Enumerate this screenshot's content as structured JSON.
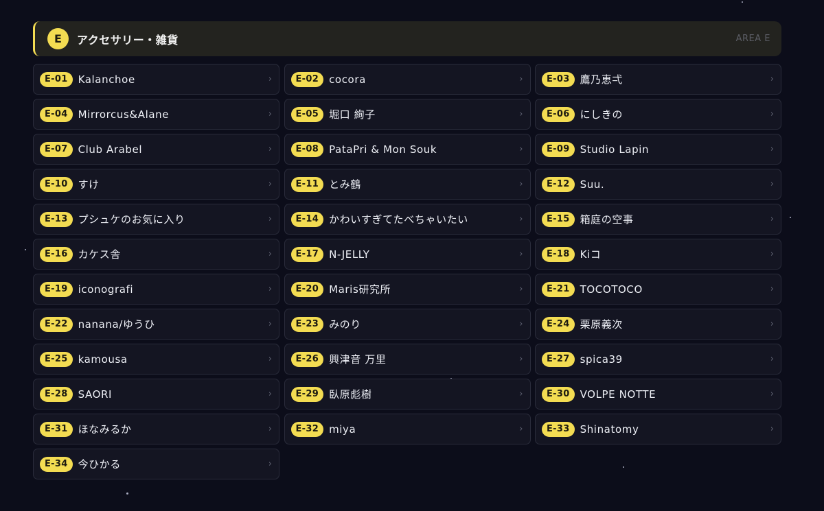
{
  "section": {
    "badge": "E",
    "title": "アクセサリー・雑貨",
    "area_label": "AREA E"
  },
  "icons": {
    "chevron": "chevron-right-icon"
  },
  "colors": {
    "background": "#0c0d1a",
    "accent": "#f3dc52",
    "card": "#141522"
  },
  "booths": [
    {
      "code": "E-01",
      "name": "Kalanchoe"
    },
    {
      "code": "E-02",
      "name": "cocora"
    },
    {
      "code": "E-03",
      "name": "鷹乃恵弌"
    },
    {
      "code": "E-04",
      "name": "Mirrorcus&Alane"
    },
    {
      "code": "E-05",
      "name": "堀口 絢子"
    },
    {
      "code": "E-06",
      "name": "にしきの"
    },
    {
      "code": "E-07",
      "name": "Club Arabel"
    },
    {
      "code": "E-08",
      "name": "PataPri & Mon Souk"
    },
    {
      "code": "E-09",
      "name": "Studio Lapin"
    },
    {
      "code": "E-10",
      "name": "すけ"
    },
    {
      "code": "E-11",
      "name": "とみ鶴"
    },
    {
      "code": "E-12",
      "name": "Suu."
    },
    {
      "code": "E-13",
      "name": "プシュケのお気に入り"
    },
    {
      "code": "E-14",
      "name": "かわいすぎてたべちゃいたい"
    },
    {
      "code": "E-15",
      "name": "箱庭の空事"
    },
    {
      "code": "E-16",
      "name": "カケス舎"
    },
    {
      "code": "E-17",
      "name": "N-JELLY"
    },
    {
      "code": "E-18",
      "name": "Kiコ"
    },
    {
      "code": "E-19",
      "name": "iconografi"
    },
    {
      "code": "E-20",
      "name": "Maris研究所"
    },
    {
      "code": "E-21",
      "name": "TOCOTOCO"
    },
    {
      "code": "E-22",
      "name": "nanana/ゆうひ"
    },
    {
      "code": "E-23",
      "name": "みのり"
    },
    {
      "code": "E-24",
      "name": "栗原義次"
    },
    {
      "code": "E-25",
      "name": "kamousa"
    },
    {
      "code": "E-26",
      "name": "興津音 万里"
    },
    {
      "code": "E-27",
      "name": "spica39"
    },
    {
      "code": "E-28",
      "name": "SAORI"
    },
    {
      "code": "E-29",
      "name": "臥原彪樹"
    },
    {
      "code": "E-30",
      "name": "VOLPE NOTTE"
    },
    {
      "code": "E-31",
      "name": "ほなみるか"
    },
    {
      "code": "E-32",
      "name": "miya"
    },
    {
      "code": "E-33",
      "name": "Shinatomy"
    },
    {
      "code": "E-34",
      "name": "今ひかる"
    }
  ]
}
